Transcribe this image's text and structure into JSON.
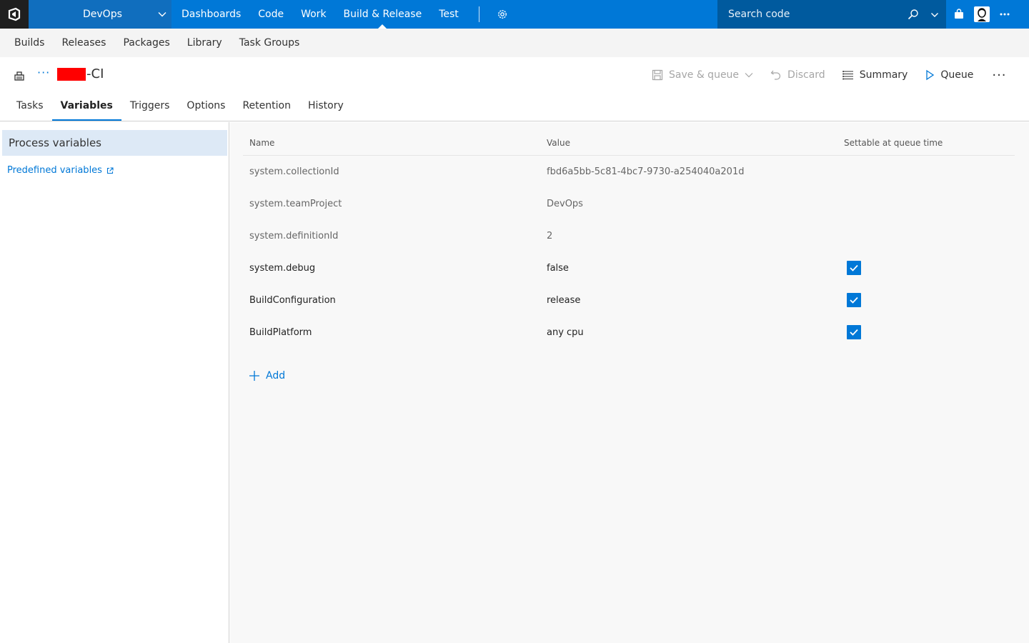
{
  "topbar": {
    "project": "DevOps",
    "hubs": [
      {
        "label": "Dashboards"
      },
      {
        "label": "Code"
      },
      {
        "label": "Work"
      },
      {
        "label": "Build & Release"
      },
      {
        "label": "Test"
      }
    ],
    "active_hub": "Build & Release",
    "search_placeholder": "Search code",
    "accent_color": "#0078d7"
  },
  "subnav": {
    "items": [
      {
        "label": "Builds"
      },
      {
        "label": "Releases"
      },
      {
        "label": "Packages"
      },
      {
        "label": "Library"
      },
      {
        "label": "Task Groups"
      }
    ]
  },
  "definition": {
    "ellipsis": "···",
    "name_suffix": "-CI"
  },
  "toolbar": {
    "save_queue": "Save & queue",
    "discard": "Discard",
    "summary": "Summary",
    "queue": "Queue",
    "more": "···"
  },
  "tabs": [
    {
      "label": "Tasks"
    },
    {
      "label": "Variables"
    },
    {
      "label": "Triggers"
    },
    {
      "label": "Options"
    },
    {
      "label": "Retention"
    },
    {
      "label": "History"
    }
  ],
  "active_tab": "Variables",
  "leftpane": {
    "selected": "Process variables",
    "link": "Predefined variables"
  },
  "grid": {
    "headers": {
      "name": "Name",
      "value": "Value",
      "settable": "Settable at queue time"
    },
    "rows": [
      {
        "name": "system.collectionId",
        "value": "fbd6a5bb-5c81-4bc7-9730-a254040a201d",
        "settable": null
      },
      {
        "name": "system.teamProject",
        "value": "DevOps",
        "settable": null
      },
      {
        "name": "system.definitionId",
        "value": "2",
        "settable": null
      },
      {
        "name": "system.debug",
        "value": "false",
        "settable": true
      },
      {
        "name": "BuildConfiguration",
        "value": "release",
        "settable": true
      },
      {
        "name": "BuildPlatform",
        "value": "any cpu",
        "settable": true
      }
    ],
    "add_label": "Add"
  }
}
